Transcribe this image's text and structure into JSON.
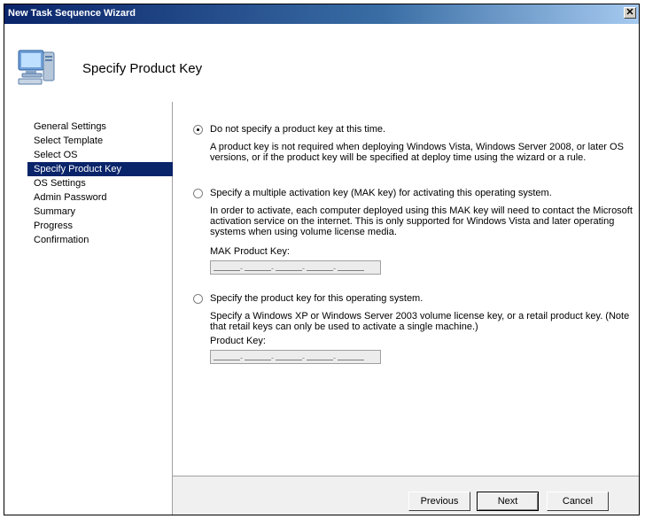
{
  "window": {
    "title": "New Task Sequence Wizard",
    "close_glyph": "✕"
  },
  "header": {
    "title": "Specify Product Key",
    "icon": "computer-icon"
  },
  "nav": {
    "items": [
      {
        "label": "General Settings"
      },
      {
        "label": "Select Template"
      },
      {
        "label": "Select OS"
      },
      {
        "label": "Specify Product Key",
        "selected": true
      },
      {
        "label": "OS Settings"
      },
      {
        "label": "Admin Password"
      },
      {
        "label": "Summary"
      },
      {
        "label": "Progress"
      },
      {
        "label": "Confirmation"
      }
    ]
  },
  "options": {
    "none": {
      "label": "Do not specify a product key at this time.",
      "desc": "A product key is not required when deploying Windows Vista, Windows Server 2008, or later OS versions, or if the product key will be specified at deploy time using the wizard or a rule.",
      "checked": true
    },
    "mak": {
      "label": "Specify a multiple activation key (MAK key) for activating this operating system.",
      "desc": "In order to activate, each computer deployed using this MAK key will need to contact the Microsoft activation service on the internet.  This is only supported for Windows Vista and later operating systems when using volume license media.",
      "field_label": "MAK Product Key:",
      "checked": false
    },
    "product": {
      "label": "Specify the product key for this operating system.",
      "desc": "Specify a Windows XP or Windows Server 2003 volume license key, or a retail product key.  (Note that retail keys can only be used to activate a single machine.)",
      "field_label": "Product Key:",
      "checked": false
    }
  },
  "buttons": {
    "previous": "Previous",
    "next": "Next",
    "cancel": "Cancel"
  },
  "colors": {
    "selection": "#0a246a",
    "titlebar": "#0a246a"
  }
}
